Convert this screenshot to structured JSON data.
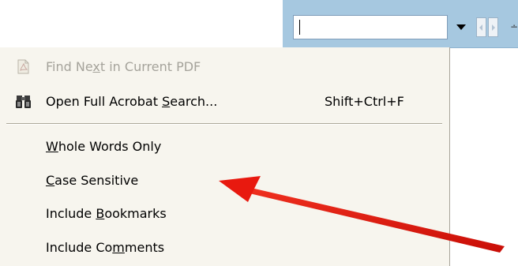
{
  "toolbar": {
    "search_value": "",
    "edge_glyph": "∸"
  },
  "menu": {
    "items": [
      {
        "pre": "Find Ne",
        "u": "x",
        "post": "t in Current PDF",
        "shortcut": "",
        "enabled": false,
        "icon": "find-pdf-icon"
      },
      {
        "pre": "Open Full Acrobat ",
        "u": "S",
        "post": "earch...",
        "shortcut": "Shift+Ctrl+F",
        "enabled": true,
        "icon": "binoculars-icon"
      },
      {
        "pre": "",
        "u": "W",
        "post": "hole Words Only",
        "shortcut": "",
        "enabled": true,
        "icon": ""
      },
      {
        "pre": "",
        "u": "C",
        "post": "ase Sensitive",
        "shortcut": "",
        "enabled": true,
        "icon": ""
      },
      {
        "pre": "Include ",
        "u": "B",
        "post": "ookmarks",
        "shortcut": "",
        "enabled": true,
        "icon": ""
      },
      {
        "pre": "Include Co",
        "u": "m",
        "post": "ments",
        "shortcut": "",
        "enabled": true,
        "icon": ""
      }
    ]
  },
  "annotation": {
    "color": "#e8190f",
    "points_to": "Case Sensitive"
  },
  "colors": {
    "toolbar_bg": "#a6c8e0",
    "menu_bg": "#f7f5ee",
    "disabled_text": "#a5a39b"
  }
}
